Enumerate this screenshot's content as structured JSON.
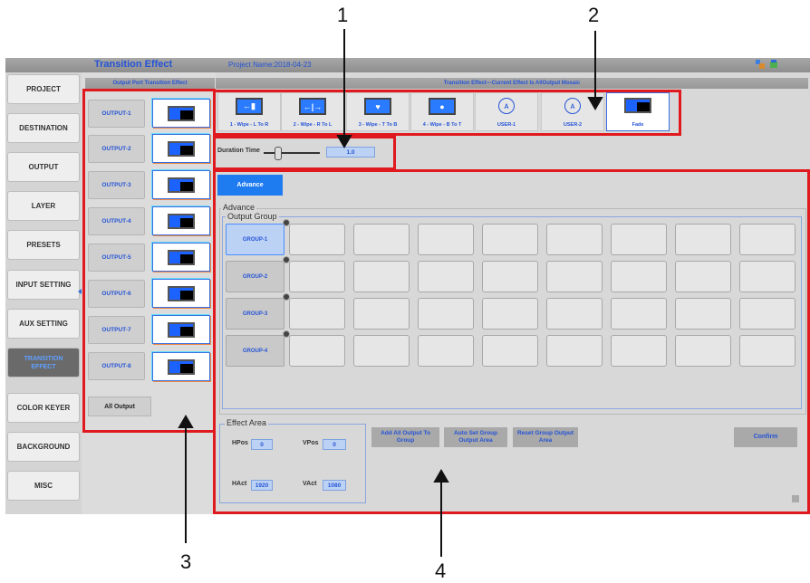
{
  "titlebar": {
    "title": "Transition Effect",
    "project": "Project Name:2018-04-23"
  },
  "sidebar": {
    "items": [
      {
        "label": "PROJECT"
      },
      {
        "label": "DESTINATION"
      },
      {
        "label": "OUTPUT"
      },
      {
        "label": "LAYER"
      },
      {
        "label": "PRESETS"
      },
      {
        "label": "INPUT SETTING"
      },
      {
        "label": "AUX SETTING"
      },
      {
        "label": "TRANSITION EFFECT"
      },
      {
        "label": "COLOR KEYER"
      },
      {
        "label": "BACKGROUND"
      },
      {
        "label": "MISC"
      }
    ],
    "active": "TRANSITION EFFECT"
  },
  "output_panel": {
    "header": "Output Port Transition Effect",
    "outputs": [
      "OUTPUT-1",
      "OUTPUT-2",
      "OUTPUT-3",
      "OUTPUT-4",
      "OUTPUT-5",
      "OUTPUT-6",
      "OUTPUT-7",
      "OUTPUT-8"
    ],
    "all_output": "All Output"
  },
  "effect_panel": {
    "header": "Transition Effect---Current Effect Is AllOutput Mosaic",
    "effects": [
      "1 - Wipe - L To R",
      "2 - Wipe - R To L",
      "3 - Wipe - T To B",
      "4 - Wipe - B To T",
      "USER-1",
      "USER-2",
      "Fade"
    ],
    "selected": "Fade"
  },
  "duration": {
    "label": "Duration Time",
    "value": "1.0"
  },
  "advance_button": "Advance",
  "advance": {
    "legend": "Advance",
    "output_group": {
      "legend": "Output Group",
      "groups": [
        "GROUP-1",
        "GROUP-2",
        "GROUP-3",
        "GROUP-4"
      ],
      "selected": "GROUP-1"
    }
  },
  "effect_area": {
    "legend": "Effect Area",
    "hpos_label": "HPos",
    "hpos": "0",
    "vpos_label": "VPos",
    "vpos": "0",
    "hact_label": "HAct",
    "hact": "1920",
    "vact_label": "VAct",
    "vact": "1080"
  },
  "buttons": {
    "add_all": "Add All Output To Group",
    "auto_set": "Auto Set Group Output Area",
    "reset": "Reset Group Output Area",
    "confirm": "Confirm"
  },
  "annotations": [
    "1",
    "2",
    "3",
    "4"
  ],
  "colors": {
    "accent": "#2453d6",
    "highlight": "#e0191f",
    "button_blue": "#1e7bf0"
  }
}
